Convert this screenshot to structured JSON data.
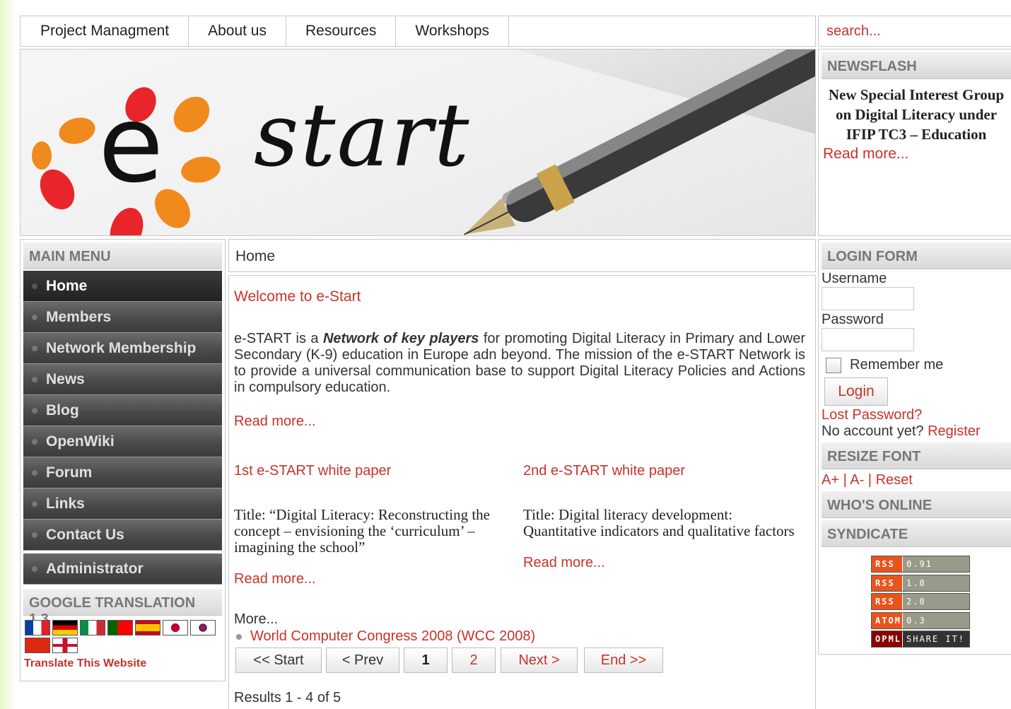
{
  "topnav": {
    "tabs": [
      "Project Managment",
      "About us",
      "Resources",
      "Workshops"
    ],
    "search_placeholder": "search..."
  },
  "banner": {
    "logo_text": "start",
    "logo_letter": "e"
  },
  "newsflash": {
    "title": "NEWSFLASH",
    "headline": "New Special Interest Group on Digital Literacy under IFIP TC3 – Education",
    "read_more": "Read more..."
  },
  "main_menu": {
    "title": "MAIN MENU",
    "items": [
      "Home",
      "Members",
      "Network Membership",
      "News",
      "Blog",
      "OpenWiki",
      "Forum",
      "Links",
      "Contact Us"
    ],
    "admin": "Administrator"
  },
  "translation": {
    "title": "GOOGLE TRANSLATION 1.3",
    "link": "Translate This Website",
    "flags": [
      "fr",
      "de",
      "it",
      "pt",
      "es",
      "jp",
      "kr",
      "cn",
      "gb"
    ]
  },
  "breadcrumb": "Home",
  "article": {
    "title": "Welcome to e-Start",
    "intro_pre": "e-START is a ",
    "intro_em": "Network of key players",
    "intro_post": " for promoting Digital Literacy in Primary and Lower Secondary (K-9) education in Europe adn beyond.  The mission of the e-START Network is to provide a universal communication base to support Digital Literacy Policies and Actions in compulsory education.",
    "read_more": "Read more..."
  },
  "papers": [
    {
      "title": "1st e-START white paper",
      "text": "Title: “Digital Literacy: Reconstructing the concept – envisioning the ‘curriculum’ – imagining the school”",
      "read_more": "Read more..."
    },
    {
      "title": "2nd e-START white paper",
      "text": "Title: Digital literacy development: Quantitative indicators and qualitative factors",
      "read_more": "Read more..."
    }
  ],
  "more": {
    "label": "More...",
    "link": "World Computer Congress 2008 (WCC 2008)"
  },
  "pagination": {
    "start": "<< Start",
    "prev": "< Prev",
    "p1": "1",
    "p2": "2",
    "next": "Next >",
    "end": "End >>"
  },
  "results": "Results 1 - 4 of 5",
  "login": {
    "title": "LOGIN FORM",
    "username_label": "Username",
    "password_label": "Password",
    "remember": "Remember me",
    "button": "Login",
    "lost": "Lost Password?",
    "no_account": "No account yet?",
    "register": "Register"
  },
  "resize_font": {
    "title": "RESIZE FONT",
    "plus": "A+",
    "sep1": " | ",
    "minus": "A-",
    "sep2": " | ",
    "reset": "Reset"
  },
  "whos_online": {
    "title": "WHO'S ONLINE"
  },
  "syndicate": {
    "title": "SYNDICATE",
    "feeds": [
      {
        "left": "RSS",
        "right": "0.91"
      },
      {
        "left": "RSS",
        "right": "1.0"
      },
      {
        "left": "RSS",
        "right": "2.0"
      },
      {
        "left": "ATOM",
        "right": "0.3"
      },
      {
        "left": "OPML",
        "right": "SHARE IT!"
      }
    ]
  },
  "colors": {
    "link": "#c8322a",
    "menu_bg": "#4a4a4a",
    "rss_orange": "#e8541c"
  }
}
